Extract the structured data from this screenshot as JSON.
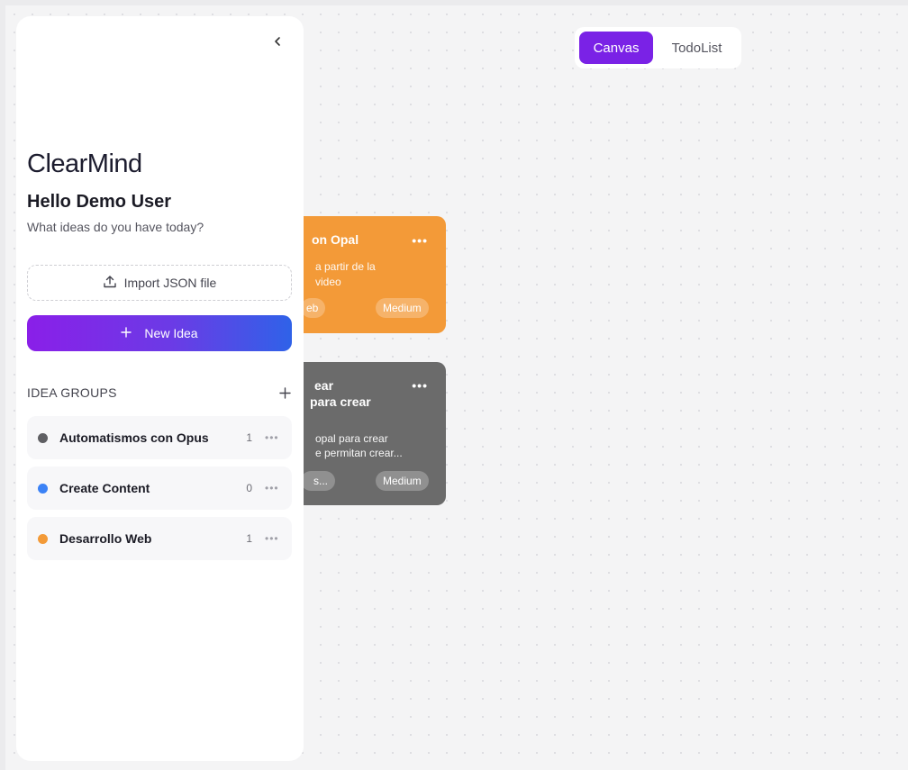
{
  "app": {
    "name": "ClearMind"
  },
  "view_toggle": {
    "options": [
      {
        "label": "Canvas",
        "active": true
      },
      {
        "label": "TodoList",
        "active": false
      }
    ],
    "active_color": "#7a22e6"
  },
  "sidebar": {
    "greeting": "Hello Demo User",
    "subtitle": "What ideas do you have today?",
    "import_label": "Import JSON file",
    "new_idea_label": "New Idea",
    "groups_title": "IDEA GROUPS",
    "groups": [
      {
        "name": "Automatismos con Opus",
        "count": "1",
        "color": "#5f5f63"
      },
      {
        "name": "Create Content",
        "count": "0",
        "color": "#3b82f6"
      },
      {
        "name": "Desarrollo Web",
        "count": "1",
        "color": "#f39a38"
      }
    ]
  },
  "cards": [
    {
      "title_lines": [
        "on Opal"
      ],
      "desc_lines": [
        "a partir de la",
        "video"
      ],
      "tag": "eb",
      "priority": "Medium",
      "color": "#f39a38"
    },
    {
      "title_lines": [
        "ear",
        "para crear"
      ],
      "desc_lines": [
        "opal para crear",
        "e permitan crear..."
      ],
      "tag": "s...",
      "priority": "Medium",
      "color": "#6b6b6b"
    }
  ],
  "icons": {
    "collapse": "chevron-left-icon",
    "upload": "upload-icon",
    "plus": "plus-icon",
    "more": "more-horizontal-icon"
  }
}
